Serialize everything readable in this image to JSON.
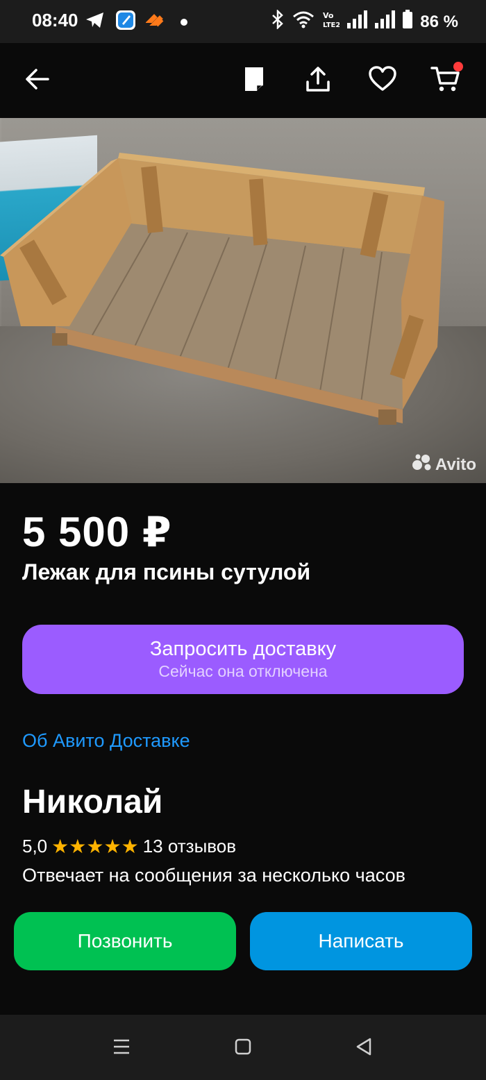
{
  "status_bar": {
    "time": "08:40",
    "battery": "86 %",
    "icons": [
      "telegram-icon",
      "app-icon",
      "orange-app-icon",
      "dot",
      "bluetooth-icon",
      "wifi-icon",
      "volte-icon",
      "signal-icon",
      "signal-icon",
      "battery-icon"
    ]
  },
  "app_bar": {
    "icons": [
      "back-arrow-icon",
      "note-icon",
      "share-icon",
      "heart-icon",
      "cart-icon"
    ],
    "cart_badge_color": "#ff3b3b"
  },
  "photo": {
    "watermark": "Avito"
  },
  "listing": {
    "price": "5 500 ₽",
    "title": "Лежак для псины сутулой"
  },
  "delivery": {
    "button_label": "Запросить доставку",
    "button_sublabel": "Сейчас она отключена",
    "link": "Об Авито Доставке",
    "button_color": "#9b5cff"
  },
  "seller": {
    "name": "Николай",
    "rating": "5,0",
    "stars": 5,
    "reviews": "13 отзывов",
    "response_time": "Отвечает на сообщения за несколько часов"
  },
  "actions": {
    "call_label": "Позвонить",
    "write_label": "Написать",
    "call_color": "#00c152",
    "write_color": "#0095e0"
  },
  "nav_bar": {
    "icons": [
      "menu-icon",
      "home-icon",
      "back-icon"
    ]
  }
}
